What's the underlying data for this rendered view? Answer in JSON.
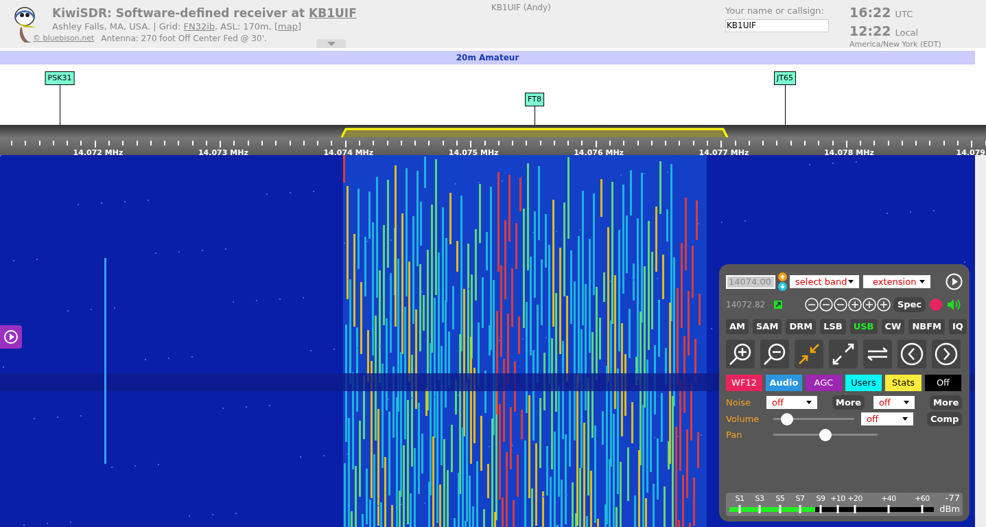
{
  "header": {
    "title": [
      {
        "kind": "text",
        "text": "KiwiSDR: Software-defined receiver at "
      },
      {
        "kind": "link",
        "text": "KB1UIF"
      }
    ],
    "location": [
      {
        "kind": "text",
        "text": "Ashley Falls, MA, USA. | Grid: "
      },
      {
        "kind": "link",
        "text": "FN32ib"
      },
      {
        "kind": "text",
        "text": ", ASL: 170m, "
      },
      {
        "kind": "link",
        "text": "[map]"
      }
    ],
    "credit": "© bluebison.net",
    "antenna": "Antenna: 270 foot Off Center Fed @ 30'.",
    "user": "KB1UIF (Andy)",
    "name_label": "Your name or callsign:",
    "name_value": "KB1UIF",
    "utc_time": "16:22",
    "utc_label": "UTC",
    "local_time": "12:22",
    "local_label": "Local",
    "timezone": "America/New York (EDT)"
  },
  "band": "20m Amateur",
  "markers": [
    {
      "label": "PSK31"
    },
    {
      "label": "FT8"
    },
    {
      "label": "JT65"
    }
  ],
  "scale": [
    "14.072 MHz",
    "14.073 MHz",
    "14.074 MHz",
    "14.075 MHz",
    "14.076 MHz",
    "14.077 MHz",
    "14.078 MHz",
    "14.079"
  ],
  "panel": {
    "frequency": "14074.00",
    "band_select": "select band",
    "extension_select": "extension",
    "readout": "14072.82",
    "spec": "Spec",
    "modes": [
      {
        "label": "AM",
        "selected": false
      },
      {
        "label": "SAM",
        "selected": false
      },
      {
        "label": "DRM",
        "selected": false
      },
      {
        "label": "LSB",
        "selected": false
      },
      {
        "label": "USB",
        "selected": true
      },
      {
        "label": "CW",
        "selected": false
      },
      {
        "label": "NBFM",
        "selected": false
      },
      {
        "label": "IQ",
        "selected": false
      }
    ],
    "tabs": [
      {
        "label": "WF12",
        "color": "#e8245e"
      },
      {
        "label": "Audio",
        "color": "#2b95e0"
      },
      {
        "label": "AGC",
        "color": "#9c27b0"
      },
      {
        "label": "Users",
        "color": "#00ffff"
      },
      {
        "label": "Stats",
        "color": "#ffeb3b"
      },
      {
        "label": "Off",
        "color": "#000000"
      }
    ],
    "noise_label": "Noise",
    "noise_value": "off",
    "more1": "More",
    "filter_value": "off",
    "more2": "More",
    "volume_label": "Volume",
    "volume": {
      "level": 0.17
    },
    "comp_value": "off",
    "comp": "Comp",
    "pan_label": "Pan",
    "pan": {
      "level": 0.5
    },
    "smeter": {
      "labels": [
        "S1",
        "S3",
        "S5",
        "S7",
        "S9",
        "+10",
        "+20",
        "+40",
        "+60"
      ],
      "level": 0.42,
      "reading": "-77",
      "unit": "dBm"
    }
  }
}
